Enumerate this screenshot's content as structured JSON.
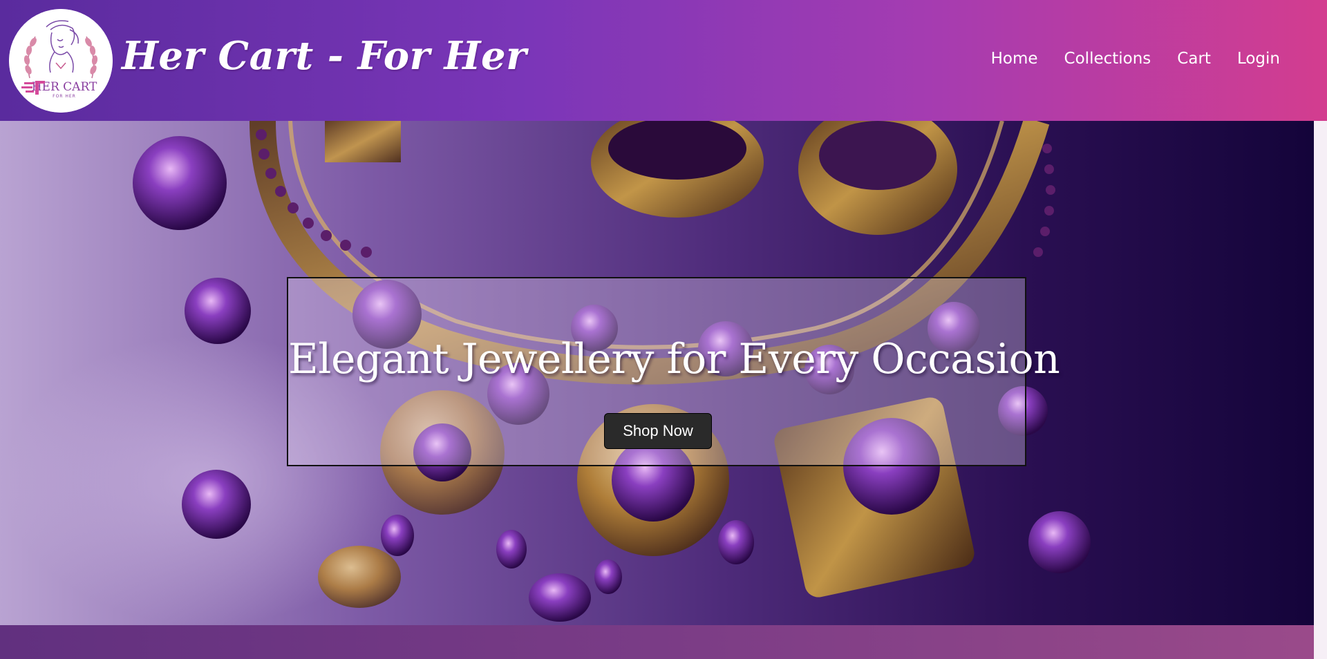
{
  "header": {
    "brand_title": "Her Cart - For Her",
    "logo": {
      "text": "HER CART",
      "subtext": "FOR HER",
      "icon": "woman-line-art-logo-icon"
    },
    "nav": [
      {
        "label": "Home"
      },
      {
        "label": "Collections"
      },
      {
        "label": "Cart"
      },
      {
        "label": "Login"
      }
    ]
  },
  "hero": {
    "title": "Elegant Jewellery for Every Occasion",
    "cta_label": "Shop Now",
    "background": "purple-amethyst-gold-jewellery-photo"
  },
  "colors": {
    "header_gradient_start": "#5a2b9e",
    "header_gradient_end": "#d33d8f",
    "button_bg": "#2a2a2a"
  }
}
